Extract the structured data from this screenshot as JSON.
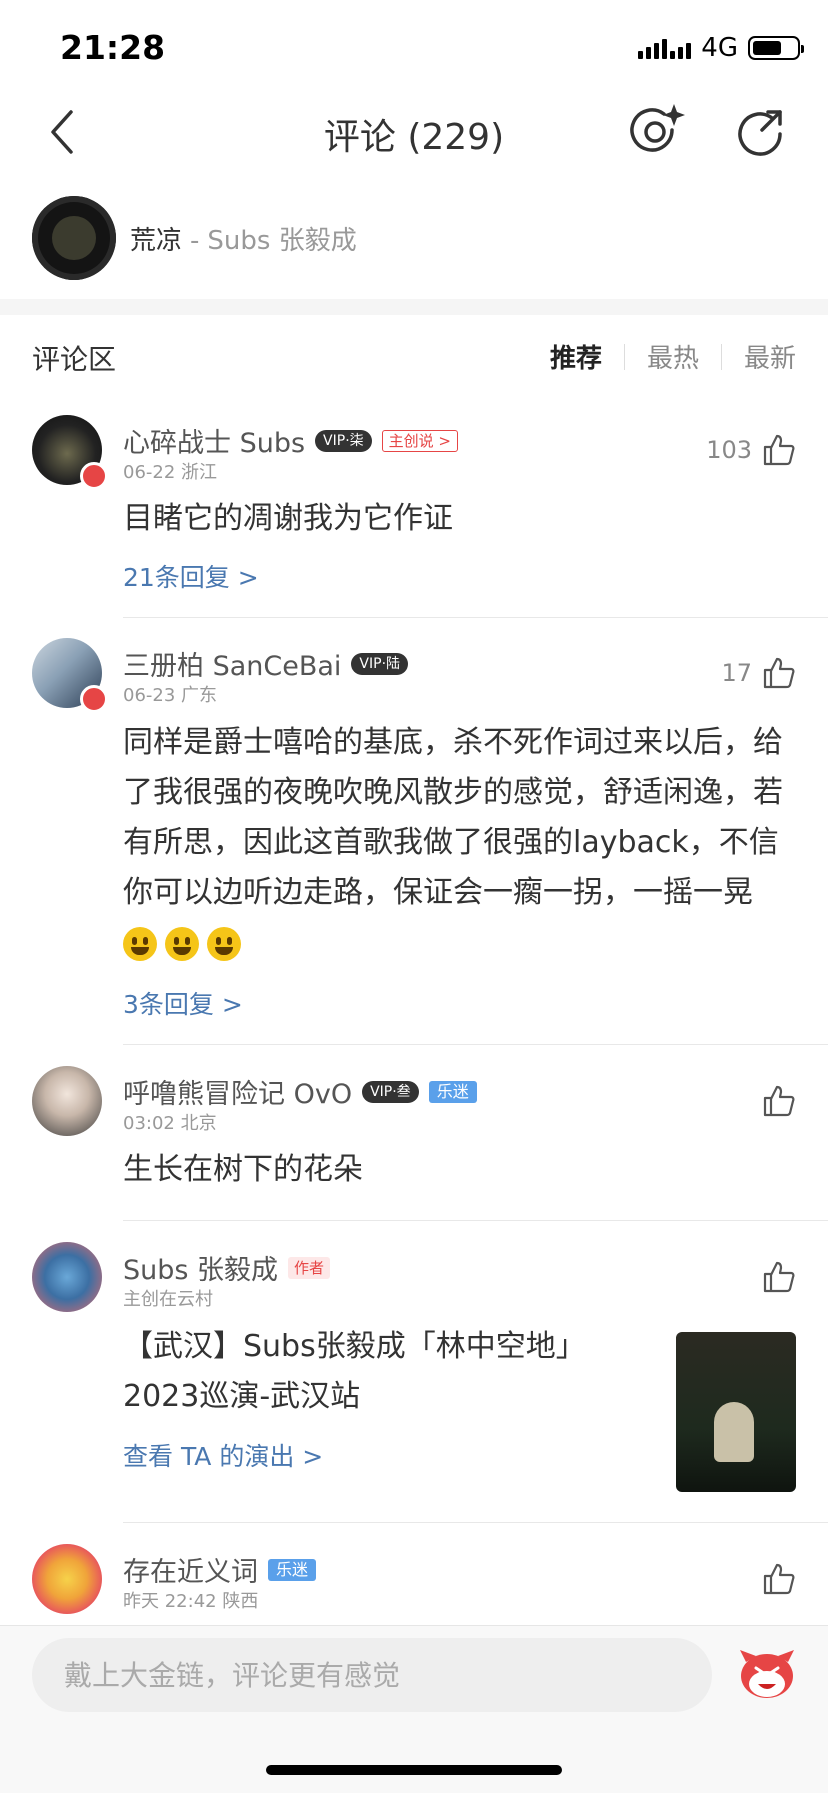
{
  "status": {
    "time": "21:28",
    "network": "4G"
  },
  "nav": {
    "title": "评论 (229)"
  },
  "song": {
    "title": "荒凉",
    "separator": "-",
    "artist": "Subs 张毅成"
  },
  "comments_section": {
    "title": "评论区",
    "sort_tabs": [
      "推荐",
      "最热",
      "最新"
    ],
    "active_sort": "推荐"
  },
  "comments": [
    {
      "username": "心碎战士 Subs",
      "vip": "VIP·柒",
      "tag": "主创说 >",
      "meta": "06-22 浙江",
      "likes": "103",
      "text": "目睹它的凋谢我为它作证",
      "replies": "21条回复 >"
    },
    {
      "username": "三册柏 SanCeBai",
      "vip": "VIP·陆",
      "meta": "06-23 广东",
      "likes": "17",
      "text": "同样是爵士嘻哈的基底，杀不死作词过来以后，给了我很强的夜晚吹晚风散步的感觉，舒适闲逸，若有所思，因此这首歌我做了很强的layback，不信你可以边听边走路，保证会一瘸一拐，一摇一晃",
      "emoji": "smiley-emoji",
      "replies": "3条回复 >"
    },
    {
      "username": "呼噜熊冒险记 OvO",
      "vip": "VIP·叁",
      "fan_tag": "乐迷",
      "meta": "03:02 北京",
      "likes": "",
      "text": "生长在树下的花朵"
    },
    {
      "username": "Subs 张毅成",
      "author_tag": "作者",
      "meta": "主创在云村",
      "likes": "",
      "text": "【武汉】Subs张毅成「林中空地」2023巡演-武汉站",
      "link": "查看 TA 的演出 >"
    },
    {
      "username": "存在近义词",
      "fan_tag": "乐迷",
      "meta": "昨天 22:42 陕西",
      "likes": ""
    }
  ],
  "input": {
    "placeholder": "戴上大金链，评论更有感觉"
  },
  "colors": {
    "accent": "#e64545",
    "link": "#4a78b0",
    "fan_tag": "#5aa0ea"
  },
  "icons": [
    "back-icon",
    "camera-sparkle-icon",
    "share-icon",
    "thumbs-up-icon",
    "mascot-icon"
  ]
}
